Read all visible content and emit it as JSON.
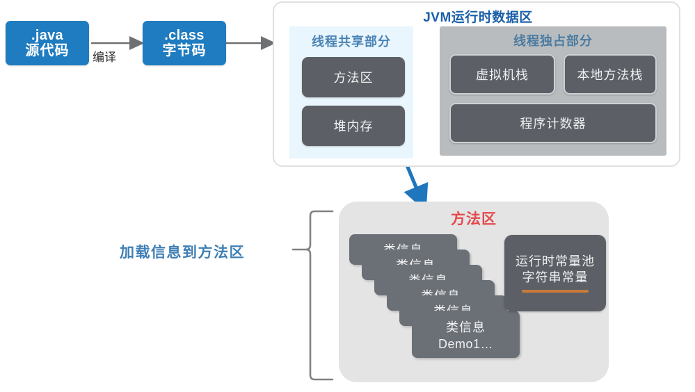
{
  "flow": {
    "source_box": {
      "line1": ".java",
      "line2": "源代码"
    },
    "compile_label": "编译",
    "class_box": {
      "line1": ".class",
      "line2": "字节码"
    }
  },
  "jvm_panel": {
    "title": "JVM运行时数据区",
    "shared": {
      "title": "线程共享部分",
      "boxes": [
        {
          "label": "方法区"
        },
        {
          "label": "堆内存"
        }
      ]
    },
    "exclusive": {
      "title": "线程独占部分",
      "boxes": [
        {
          "label": "虚拟机栈"
        },
        {
          "label": "本地方法栈"
        },
        {
          "label": "程序计数器"
        }
      ]
    }
  },
  "method_area": {
    "brace_label": "加载信息到方法区",
    "title": "方法区",
    "class_cards": [
      {
        "line1": "类信息",
        "line2": ""
      },
      {
        "line1": "类信息",
        "line2": ""
      },
      {
        "line1": "类信息",
        "line2": ""
      },
      {
        "line1": "类信息",
        "line2": ""
      },
      {
        "line1": "类信息",
        "line2": ""
      },
      {
        "line1": "类信息",
        "line2": "Demo1…"
      }
    ],
    "constant_pool": {
      "line1": "运行时常量池",
      "line2": "字符串常量"
    }
  },
  "colors": {
    "blue_box": "#1f7cc0",
    "jvm_title": "#1b5fa8",
    "sub_title": "#4a83b4",
    "shared_bg": "#e9f6fd",
    "exclusive_bg": "#b9bcbe",
    "grey_box": "#5c6066",
    "method_area_title": "#e5484b",
    "method_area_bg": "#e4e4e4",
    "pool_underline": "#c87a3a",
    "arrow_grey": "#6f7072",
    "arrow_blue": "#1f76bd",
    "brace_label": "#3f7fb5"
  }
}
